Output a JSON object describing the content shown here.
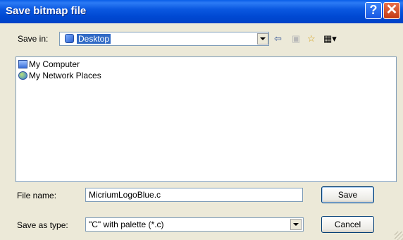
{
  "window": {
    "title": "Save bitmap file",
    "help_glyph": "?",
    "close_glyph": "✕"
  },
  "save_in": {
    "label": "Save in:",
    "value": "Desktop"
  },
  "toolbar": {
    "back_glyph": "⇦",
    "up_glyph": "▣",
    "new_folder_glyph": "☆",
    "views_glyph": "▦▾"
  },
  "files": [
    {
      "name": "My Computer",
      "icon": "my-computer-icon"
    },
    {
      "name": "My Network Places",
      "icon": "network-places-icon"
    }
  ],
  "file_name": {
    "label": "File name:",
    "value": "MicriumLogoBlue.c"
  },
  "save_as_type": {
    "label": "Save as type:",
    "value": "\"C\" with palette (*.c)"
  },
  "buttons": {
    "save": "Save",
    "cancel": "Cancel"
  },
  "colors": {
    "titlebar": "#0a58e0",
    "dialog_bg": "#ece9d8",
    "selection": "#316ac5"
  }
}
